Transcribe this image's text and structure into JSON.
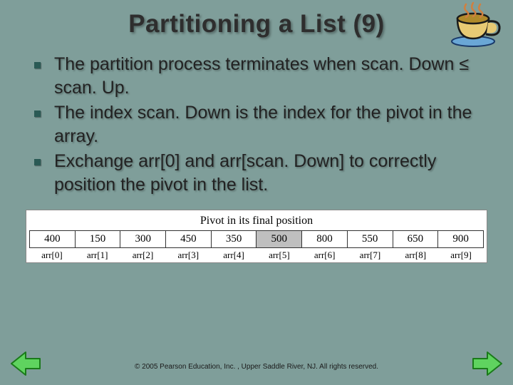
{
  "title": "Partitioning a List (9)",
  "bullets": [
    "The partition process terminates when scan. Down ≤ scan. Up.",
    "The index scan. Down is the index for the pivot in the array.",
    "Exchange arr[0] and arr[scan. Down] to correctly position the pivot in the list."
  ],
  "figure": {
    "caption": "Pivot in its final position",
    "cells": [
      "400",
      "150",
      "300",
      "450",
      "350",
      "500",
      "800",
      "550",
      "650",
      "900"
    ],
    "pivotIndex": 5,
    "labels": [
      "arr[0]",
      "arr[1]",
      "arr[2]",
      "arr[3]",
      "arr[4]",
      "arr[5]",
      "arr[6]",
      "arr[7]",
      "arr[8]",
      "arr[9]"
    ]
  },
  "footer": "© 2005 Pearson Education, Inc. , Upper Saddle River, NJ.  All rights reserved.",
  "icons": {
    "teacup": "teacup-icon",
    "prev": "prev-arrow",
    "next": "next-arrow"
  },
  "colors": {
    "background": "#7f9e9a",
    "bulletSquare": "#2a5a55",
    "pivotFill": "#bfbfbf",
    "arrowFill": "#5fd35f",
    "arrowStroke": "#1a7a1a",
    "cupBody": "#e8ca74",
    "cupRim": "#b08a2a",
    "steam": "#d08040",
    "saucer": "#6aa7d6"
  }
}
